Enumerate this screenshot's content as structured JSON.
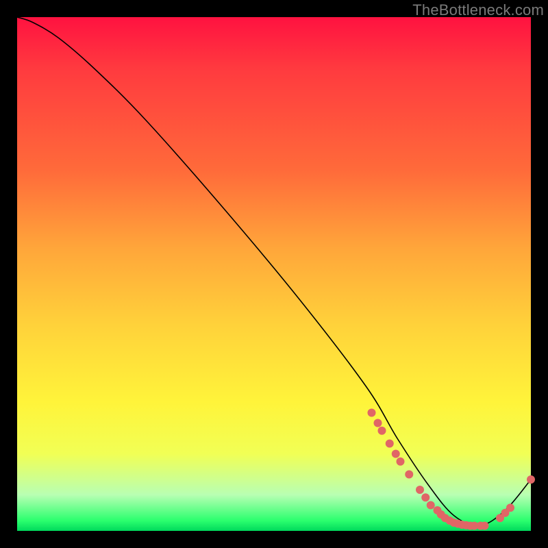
{
  "watermark": "TheBottleneck.com",
  "chart_data": {
    "type": "line",
    "title": "",
    "xlabel": "",
    "ylabel": "",
    "xlim": [
      0,
      100
    ],
    "ylim": [
      0,
      100
    ],
    "series": [
      {
        "name": "bottleneck-curve",
        "x": [
          0,
          3,
          8,
          15,
          25,
          40,
          55,
          68,
          74,
          80,
          85,
          90,
          95,
          100
        ],
        "y": [
          100,
          99,
          96,
          90,
          80,
          63,
          45,
          28,
          18,
          9,
          3,
          1,
          4,
          10
        ]
      }
    ],
    "highlight_points": {
      "name": "scatter-dots",
      "color": "#e06666",
      "x": [
        69,
        70.2,
        71,
        72.5,
        73.7,
        74.6,
        76.3,
        78.4,
        79.5,
        80.5,
        81.8,
        82.5,
        83.3,
        84.2,
        85,
        85.8,
        86.6,
        87.4,
        88.2,
        89,
        90.2,
        91,
        94,
        95,
        96,
        100
      ],
      "y": [
        23,
        21,
        19.5,
        17,
        15,
        13.5,
        11,
        8,
        6.5,
        5,
        4,
        3.2,
        2.5,
        2,
        1.6,
        1.4,
        1.2,
        1.1,
        1,
        1,
        1,
        1,
        2.5,
        3.5,
        4.5,
        10
      ]
    }
  }
}
